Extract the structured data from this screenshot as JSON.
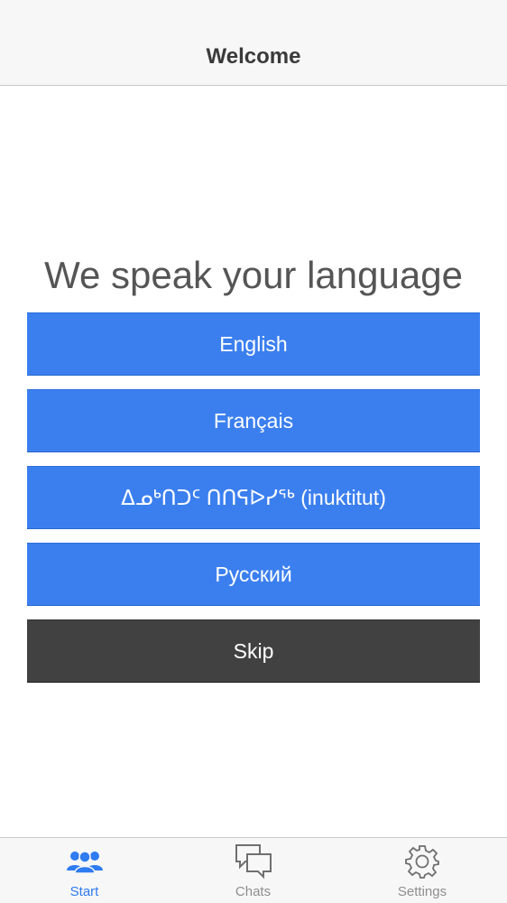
{
  "header": {
    "title": "Welcome"
  },
  "main": {
    "headline": "We speak your language",
    "languages": [
      {
        "label": "English"
      },
      {
        "label": "Français"
      },
      {
        "label": "ᐃᓄᒃᑎᑐᑦ ᑎᑎᕋᐅᓯᖅ (inuktitut)"
      },
      {
        "label": "Русский"
      }
    ],
    "skip_label": "Skip"
  },
  "tabbar": {
    "tabs": [
      {
        "label": "Start",
        "icon": "people-icon",
        "active": true
      },
      {
        "label": "Chats",
        "icon": "chat-bubbles-icon",
        "active": false
      },
      {
        "label": "Settings",
        "icon": "gear-icon",
        "active": false
      }
    ]
  },
  "colors": {
    "accent": "#3b7fef",
    "skip": "#414141",
    "tab_active": "#2f7bf0",
    "tab_inactive": "#8e8e8e"
  }
}
